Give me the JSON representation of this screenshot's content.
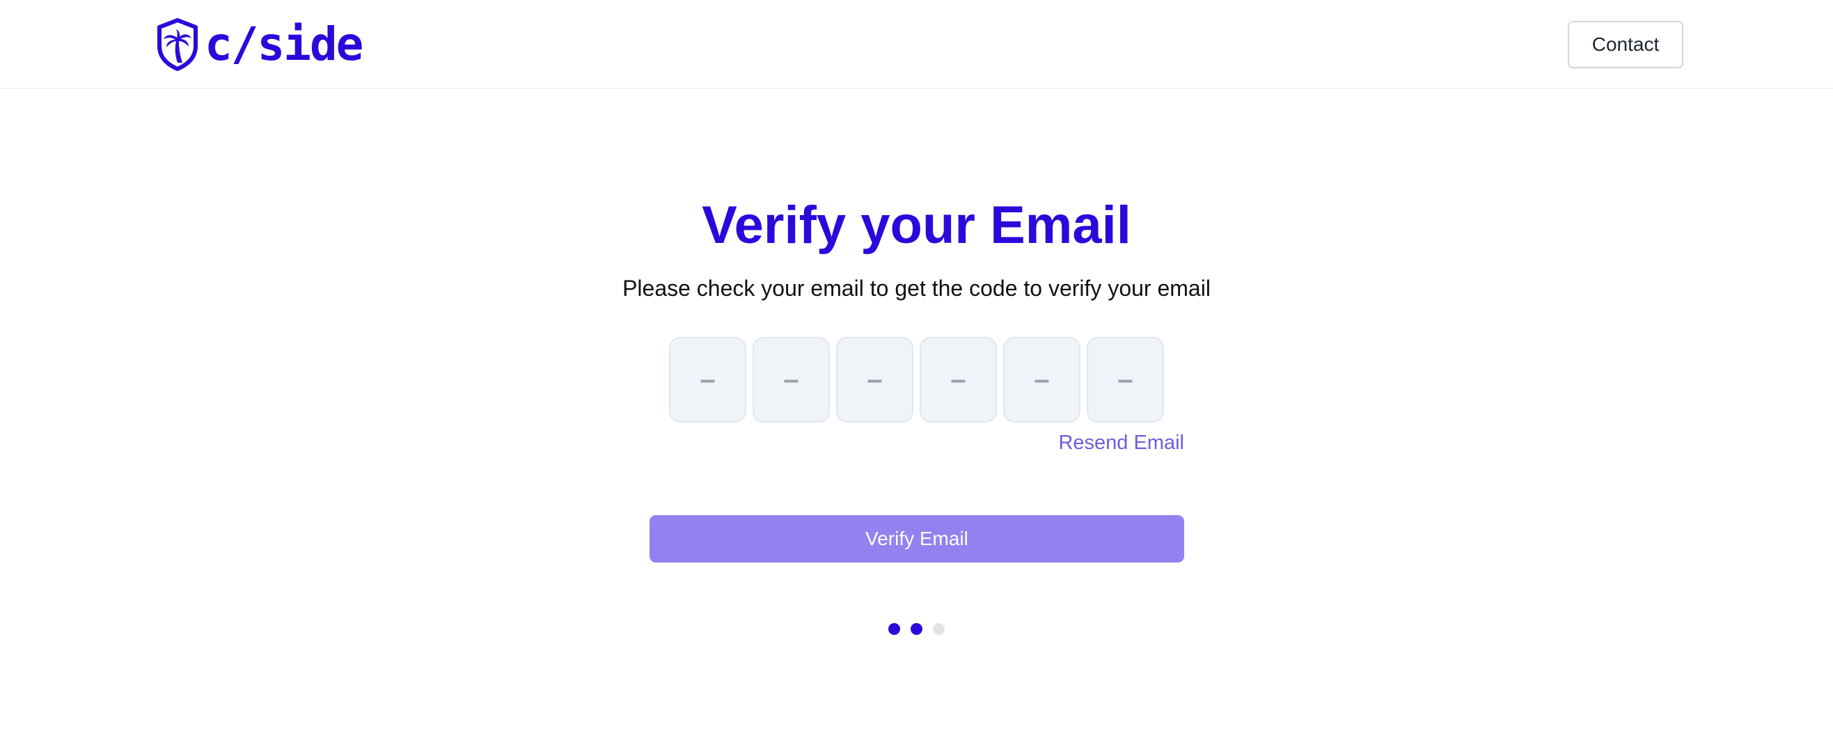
{
  "header": {
    "brand_name": "c/side",
    "logo_icon": "shield-palm-tree-icon",
    "contact_label": "Contact"
  },
  "main": {
    "title": "Verify your Email",
    "subtitle": "Please check your email to get the code to verify your email",
    "otp": {
      "length": 6,
      "placeholder": "–",
      "values": [
        "",
        "",
        "",
        "",
        "",
        ""
      ]
    },
    "resend_label": "Resend Email",
    "verify_label": "Verify Email"
  },
  "progress": {
    "total_steps": 3,
    "current_step": 2
  },
  "colors": {
    "brand": "#2a0adb",
    "button_disabled": "#9381ef",
    "link": "#6d5ce0",
    "dot_inactive": "#e2e2e4"
  }
}
